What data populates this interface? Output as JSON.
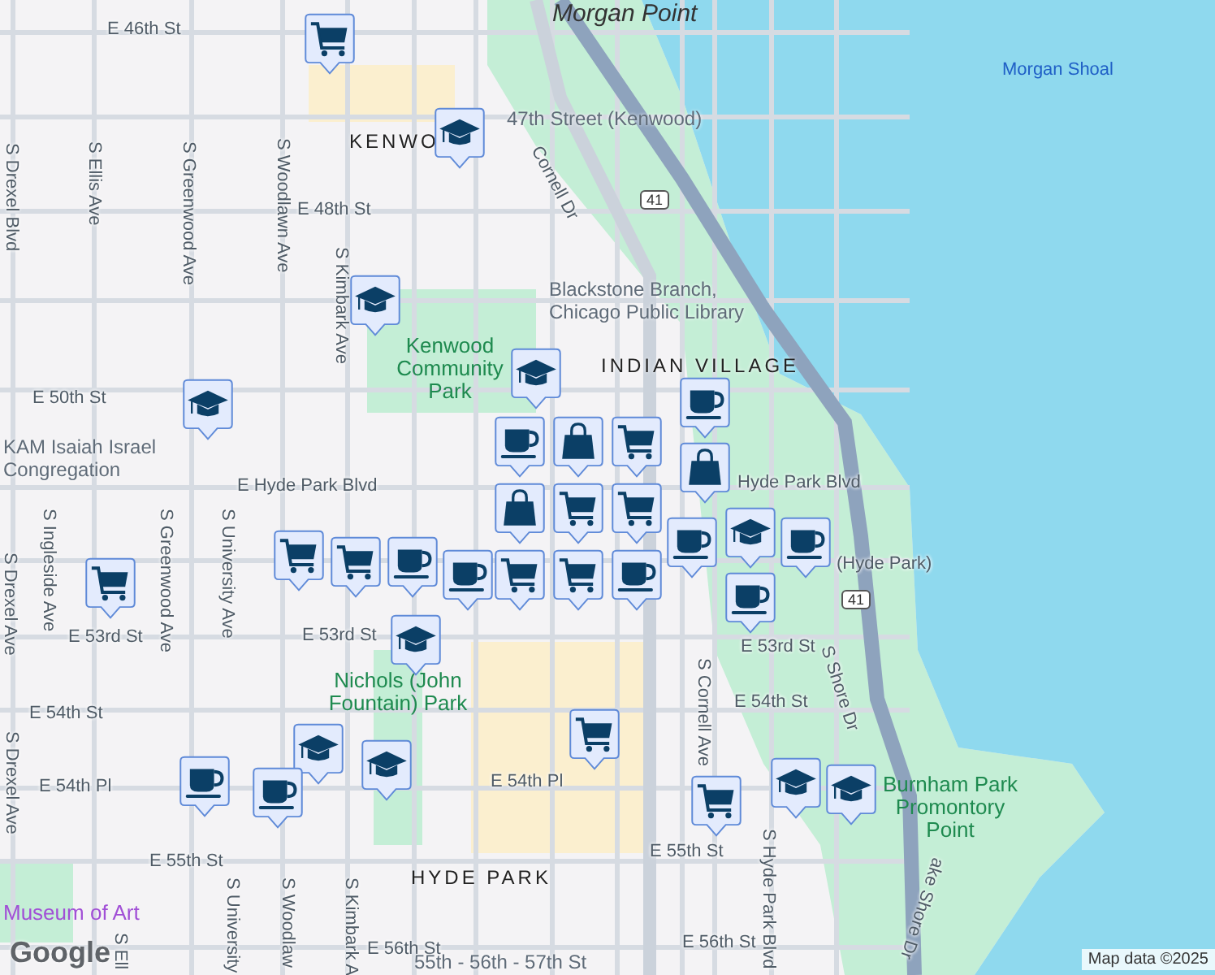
{
  "map": {
    "streets": [
      {
        "text": "E 46th St"
      },
      {
        "text": "E 48th St"
      },
      {
        "text": "E 50th St"
      },
      {
        "text": "E Hyde Park Blvd"
      },
      {
        "text": "Hyde Park Blvd"
      },
      {
        "text": "E 53rd St"
      },
      {
        "text": "E 53rd St"
      },
      {
        "text": "E 53rd St"
      },
      {
        "text": "E 54th St"
      },
      {
        "text": "E 54th St"
      },
      {
        "text": "E 54th Pl"
      },
      {
        "text": "E 54th Pl"
      },
      {
        "text": "E 55th St"
      },
      {
        "text": "E 55th St"
      },
      {
        "text": "E 56th St"
      },
      {
        "text": "E 56th St"
      },
      {
        "text": "(Hyde Park)"
      },
      {
        "text": "S Drexel Blvd"
      },
      {
        "text": "S Ellis Ave"
      },
      {
        "text": "S Greenwood Ave"
      },
      {
        "text": "S Woodlawn Ave"
      },
      {
        "text": "S Kimbark Ave"
      },
      {
        "text": "S Ingleside Ave"
      },
      {
        "text": "S Drexel Ave"
      },
      {
        "text": "S Greenwood Ave"
      },
      {
        "text": "S University Ave"
      },
      {
        "text": "S Drexel Ave"
      },
      {
        "text": "S University"
      },
      {
        "text": "S Woodlaw"
      },
      {
        "text": "S Kimbark A"
      },
      {
        "text": "S Ell"
      },
      {
        "text": "S Cornell Ave"
      },
      {
        "text": "S Hyde Park Blvd"
      },
      {
        "text": "S Shore Dr"
      },
      {
        "text": "ake Shore Dr"
      },
      {
        "text": "Cornell Dr"
      }
    ],
    "neighborhoods": [
      {
        "text": "KENWO"
      },
      {
        "text": "INDIAN VILLAGE"
      },
      {
        "text": "HYDE PARK"
      }
    ],
    "parks": [
      {
        "text": "Kenwood Community Park"
      },
      {
        "text": "Nichols (John Fountain) Park"
      },
      {
        "text": "Burnham Park Promontory Point"
      }
    ],
    "places": [
      {
        "text": "Blackstone Branch, Chicago Public Library"
      },
      {
        "text": "KAM Isaiah Israel Congregation"
      },
      {
        "text": "47th Street (Kenwood)"
      },
      {
        "text": "55th - 56th - 57th St"
      }
    ],
    "museum": "Museum of Art",
    "water": [
      {
        "text": "Morgan Point",
        "kind": "point"
      },
      {
        "text": "Morgan Shoal",
        "kind": "shoal"
      }
    ],
    "shields": [
      "41",
      "41"
    ],
    "pins": [
      {
        "kind": "cart"
      },
      {
        "kind": "cap"
      },
      {
        "kind": "cap"
      },
      {
        "kind": "cap"
      },
      {
        "kind": "cap"
      },
      {
        "kind": "cup"
      },
      {
        "kind": "bag"
      },
      {
        "kind": "cup"
      },
      {
        "kind": "bag"
      },
      {
        "kind": "cart"
      },
      {
        "kind": "bag"
      },
      {
        "kind": "cart"
      },
      {
        "kind": "cart"
      },
      {
        "kind": "cart"
      },
      {
        "kind": "cart"
      },
      {
        "kind": "cart"
      },
      {
        "kind": "cup"
      },
      {
        "kind": "cup"
      },
      {
        "kind": "cup"
      },
      {
        "kind": "cart"
      },
      {
        "kind": "cup"
      },
      {
        "kind": "cap"
      },
      {
        "kind": "cup"
      },
      {
        "kind": "cup"
      },
      {
        "kind": "cap"
      },
      {
        "kind": "cart"
      },
      {
        "kind": "cart"
      },
      {
        "kind": "cap"
      },
      {
        "kind": "cap"
      },
      {
        "kind": "cup"
      },
      {
        "kind": "cup"
      },
      {
        "kind": "cart"
      },
      {
        "kind": "cap"
      },
      {
        "kind": "cap"
      }
    ],
    "logo": "Google",
    "attribution": "Map data ©2025"
  }
}
